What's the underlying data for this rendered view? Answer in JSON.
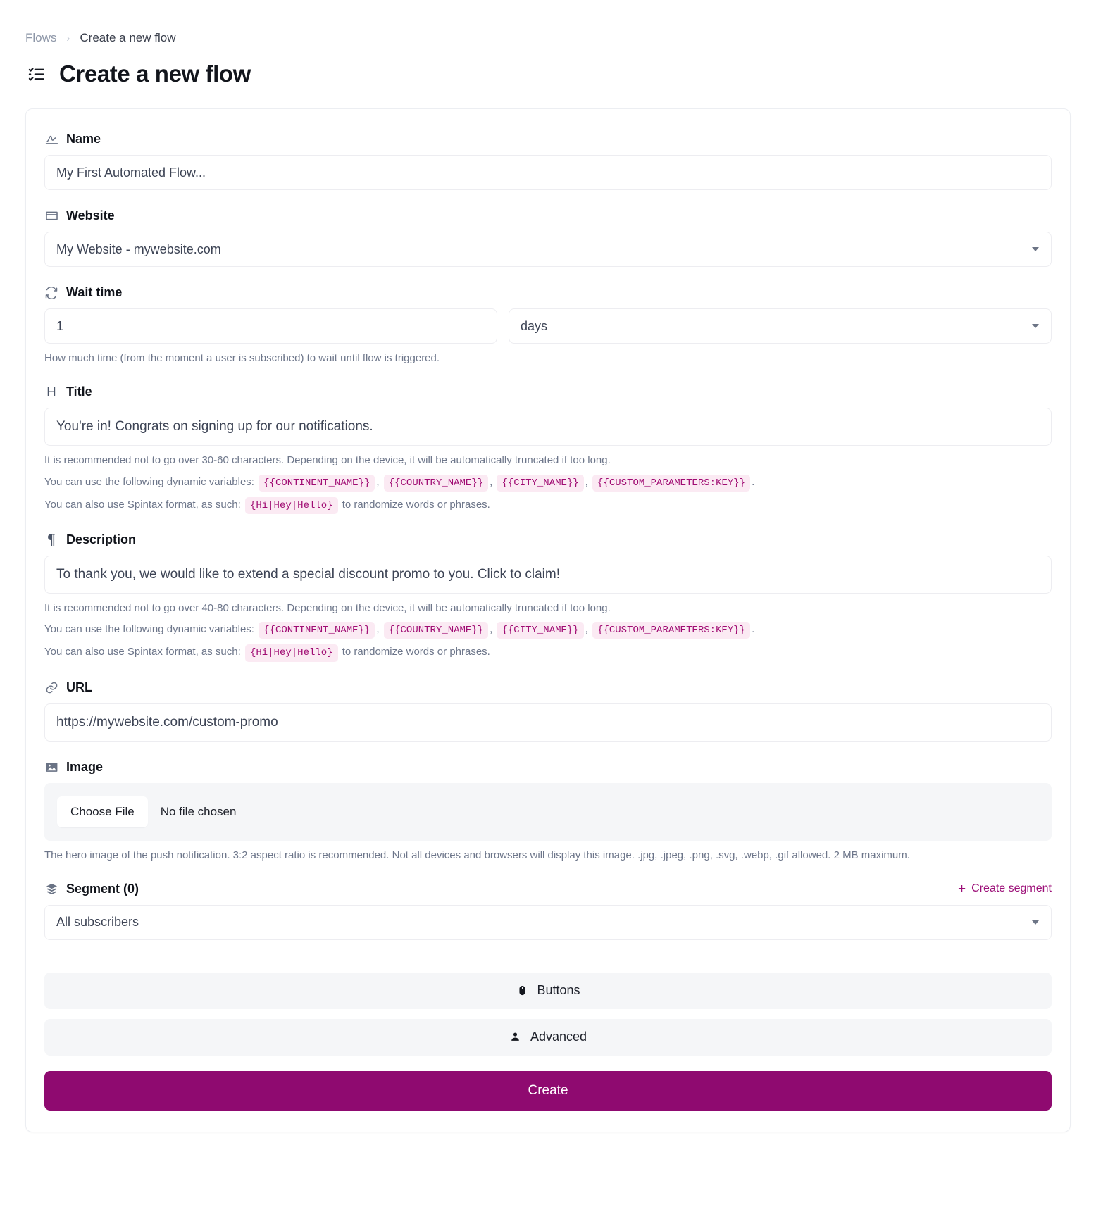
{
  "breadcrumb": {
    "parent": "Flows",
    "separator": "›",
    "current": "Create a new flow"
  },
  "header": {
    "title": "Create a new flow",
    "icon": "checklist-icon"
  },
  "form": {
    "name": {
      "label": "Name",
      "icon": "signature-icon",
      "placeholder": "My First Automated Flow...",
      "value": ""
    },
    "website": {
      "label": "Website",
      "icon": "browser-window-icon",
      "value": "My Website - mywebsite.com"
    },
    "wait_time": {
      "label": "Wait time",
      "icon": "sync-icon",
      "amount": "1",
      "unit": "days",
      "helper": "How much time (from the moment a user is subscribed) to wait until flow is triggered."
    },
    "title": {
      "label": "Title",
      "icon": "heading-h-icon",
      "value": "You're in! Congrats on signing up for our notifications.",
      "helper_length": "It is recommended not to go over 30-60 characters. Depending on the device, it will be automatically truncated if too long.",
      "helper_vars_prefix": "You can use the following dynamic variables:",
      "variables": [
        "{{CONTINENT_NAME}}",
        "{{COUNTRY_NAME}}",
        "{{CITY_NAME}}",
        "{{CUSTOM_PARAMETERS:KEY}}"
      ],
      "helper_spintax_prefix": "You can also use Spintax format, as such:",
      "spintax_example": "{Hi|Hey|Hello}",
      "helper_spintax_suffix": "to randomize words or phrases."
    },
    "description": {
      "label": "Description",
      "icon": "pilcrow-icon",
      "value": "To thank you, we would like to extend a special discount promo to you. Click to claim!",
      "helper_length": "It is recommended not to go over 40-80 characters. Depending on the device, it will be automatically truncated if too long.",
      "helper_vars_prefix": "You can use the following dynamic variables:",
      "variables": [
        "{{CONTINENT_NAME}}",
        "{{COUNTRY_NAME}}",
        "{{CITY_NAME}}",
        "{{CUSTOM_PARAMETERS:KEY}}"
      ],
      "helper_spintax_prefix": "You can also use Spintax format, as such:",
      "spintax_example": "{Hi|Hey|Hello}",
      "helper_spintax_suffix": "to randomize words or phrases."
    },
    "url": {
      "label": "URL",
      "icon": "link-icon",
      "value": "https://mywebsite.com/custom-promo"
    },
    "image": {
      "label": "Image",
      "icon": "image-icon",
      "choose_file_label": "Choose File",
      "file_status": "No file chosen",
      "helper": "The hero image of the push notification. 3:2 aspect ratio is recommended. Not all devices and browsers will display this image. .jpg, .jpeg, .png, .svg, .webp, .gif allowed. 2 MB maximum."
    },
    "segment": {
      "label": "Segment (0)",
      "icon": "layers-icon",
      "create_link": "Create segment",
      "create_link_icon": "plus-icon",
      "value": "All subscribers"
    },
    "sections": [
      {
        "label": "Buttons",
        "icon": "mouse-icon"
      },
      {
        "label": "Advanced",
        "icon": "user-icon"
      }
    ],
    "submit": {
      "label": "Create"
    }
  },
  "colors": {
    "accent": "#8f0a70",
    "link": "#9c0f78",
    "chip_bg": "#fbeaf3",
    "chip_text": "#a00c73",
    "panel_bg": "#f5f6f8"
  }
}
